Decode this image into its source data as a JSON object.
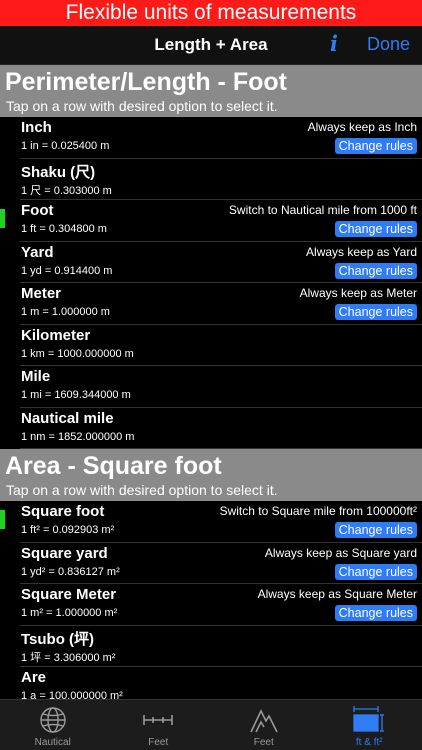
{
  "banner": "Flexible units of measurements",
  "navbar": {
    "title": "Length + Area",
    "info": "i",
    "done": "Done"
  },
  "perimeter": {
    "title": "Perimeter/Length - Foot",
    "hint": "Tap on a row with desired option to select it.",
    "rows": [
      {
        "name": "Inch",
        "conv": "1 in = 0.025400 m",
        "rule": "Always keep as Inch",
        "button": "Change rules"
      },
      {
        "name": "Shaku (尺)",
        "conv": "1 尺 = 0.303000 m"
      },
      {
        "name": "Foot",
        "conv": "1 ft = 0.304800 m",
        "rule": "Switch to Nautical mile from 1000 ft",
        "button": "Change rules"
      },
      {
        "name": "Yard",
        "conv": "1 yd = 0.914400 m",
        "rule": "Always keep as Yard",
        "button": "Change rules"
      },
      {
        "name": "Meter",
        "conv": "1 m = 1.000000 m",
        "rule": "Always keep as Meter",
        "button": "Change rules"
      },
      {
        "name": "Kilometer",
        "conv": "1 km = 1000.000000 m"
      },
      {
        "name": "Mile",
        "conv": "1 mi = 1609.344000 m"
      },
      {
        "name": "Nautical mile",
        "conv": "1 nm = 1852.000000 m"
      }
    ]
  },
  "area": {
    "title": "Area - Square foot",
    "hint": "Tap on a row with desired option to select it.",
    "rows": [
      {
        "name": "Square foot",
        "conv": "1 ft² = 0.092903 m²",
        "rule": "Switch to Square mile from 100000ft²",
        "button": "Change rules"
      },
      {
        "name": "Square yard",
        "conv": "1 yd² = 0.836127 m²",
        "rule": "Always keep as Square yard",
        "button": "Change rules"
      },
      {
        "name": "Square Meter",
        "conv": "1 m² = 1.000000 m²",
        "rule": "Always keep as Square Meter",
        "button": "Change rules"
      },
      {
        "name": "Tsubo (坪)",
        "conv": "1 坪 = 3.306000 m²"
      },
      {
        "name": "Are",
        "conv": "1 a = 100.000000 m²"
      }
    ]
  },
  "tabs": [
    {
      "label": "Nautical",
      "icon": "globe-icon"
    },
    {
      "label": "Feet",
      "icon": "ruler-icon"
    },
    {
      "label": "Feet",
      "icon": "mountain-icon"
    },
    {
      "label": "ft & ft²",
      "icon": "area-icon",
      "active": true
    }
  ],
  "colors": {
    "banner": "#ff1a1a",
    "accent": "#2e7cf6",
    "selected": "#21d321",
    "section": "#8a8a8a"
  }
}
